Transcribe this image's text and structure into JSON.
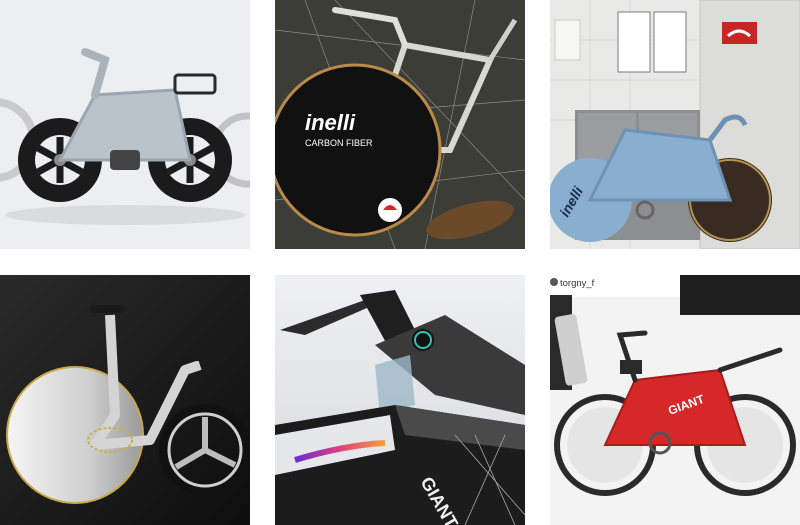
{
  "grid": {
    "tiles": [
      {
        "id": "tile-1",
        "description_label": ""
      },
      {
        "id": "tile-2",
        "wheel_text": "inelli",
        "wheel_subtext": "CARBON FIBER"
      },
      {
        "id": "tile-3",
        "wheel_text": "inelli"
      },
      {
        "id": "tile-4"
      },
      {
        "id": "tile-5",
        "frame_text": "GIANT"
      },
      {
        "id": "tile-6",
        "username": "torgny_f",
        "frame_text": "GIANT"
      }
    ]
  },
  "colors": {
    "tile1_bg": "#eceeef",
    "tile2_bg": "#2e2f2a",
    "tile3_bg": "#e9e9e7",
    "tile4_bg": "#1a1a1a",
    "tile5_bg": "#e8ebee",
    "tile6_bg": "#f3f3f3",
    "accent_red": "#d62828"
  }
}
